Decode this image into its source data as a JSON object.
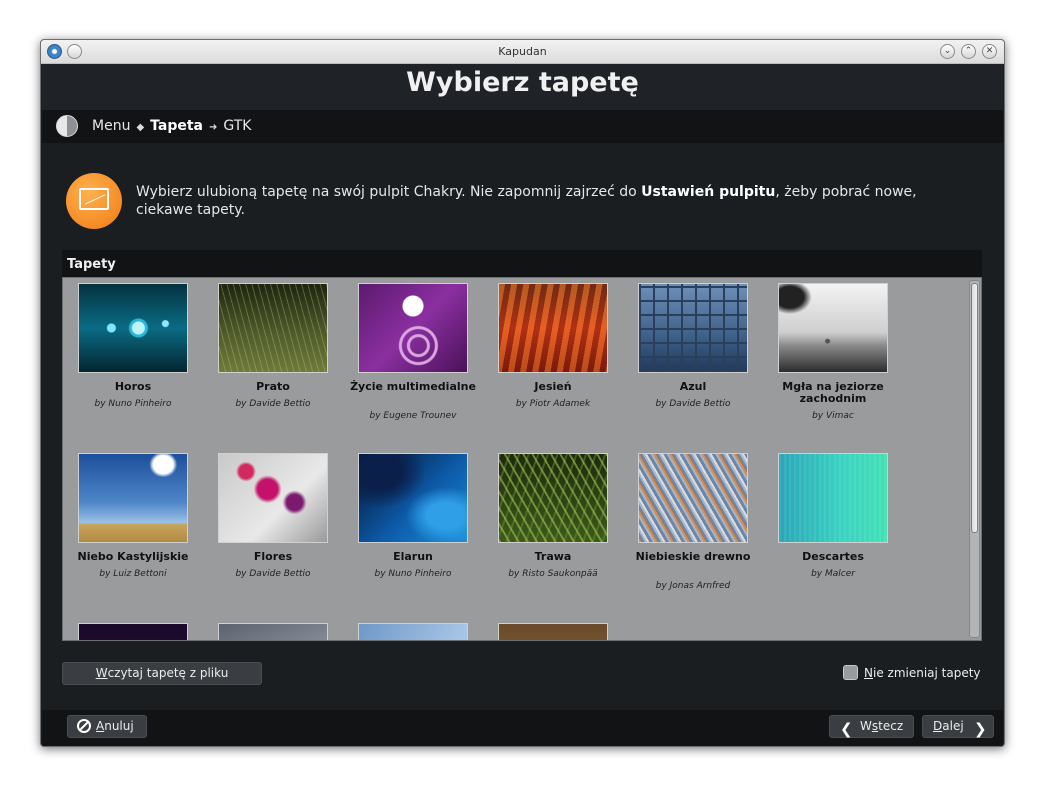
{
  "window": {
    "title": "Kapudan"
  },
  "header": {
    "title": "Wybierz tapetę"
  },
  "breadcrumb": {
    "menu": "Menu",
    "current": "Tapeta",
    "next": "GTK"
  },
  "intro": {
    "text_before": "Wybierz ulubioną tapetę na swój pulpit Chakry. Nie zapomnij zajrzeć do ",
    "text_bold": "Ustawień pulpitu",
    "text_after": ", żeby pobrać nowe, ciekawe tapety."
  },
  "gallery": {
    "label": "Tapety",
    "items": [
      {
        "name": "Horos",
        "author": "by Nuno Pinheiro"
      },
      {
        "name": "Prato",
        "author": "by Davide Bettio"
      },
      {
        "name": "Życie multimedialne",
        "author": "by Eugene Trounev"
      },
      {
        "name": "Jesień",
        "author": "by Piotr Adamek"
      },
      {
        "name": "Azul",
        "author": "by Davide Bettio"
      },
      {
        "name": "Mgła na jeziorze zachodnim",
        "author": "by Vimac"
      },
      {
        "name": "Niebo Kastylijskie",
        "author": "by Luiz Bettoni"
      },
      {
        "name": "Flores",
        "author": "by Davide Bettio"
      },
      {
        "name": "Elarun",
        "author": "by Nuno Pinheiro"
      },
      {
        "name": "Trawa",
        "author": "by Risto Saukonpää"
      },
      {
        "name": "Niebieskie drewno",
        "author": "by Jonas Arnfred"
      },
      {
        "name": "Descartes",
        "author": "by Malcer"
      }
    ]
  },
  "actions": {
    "load_prefix": "W",
    "load_rest": "czytaj tapetę z pliku",
    "nochange_prefix": "N",
    "nochange_rest": "ie zmieniaj tapety"
  },
  "footer": {
    "cancel_prefix": "A",
    "cancel_rest": "nuluj",
    "back_a": "W",
    "back_b": "s",
    "back_c": "tecz",
    "next_prefix": "D",
    "next_rest": "alej"
  }
}
